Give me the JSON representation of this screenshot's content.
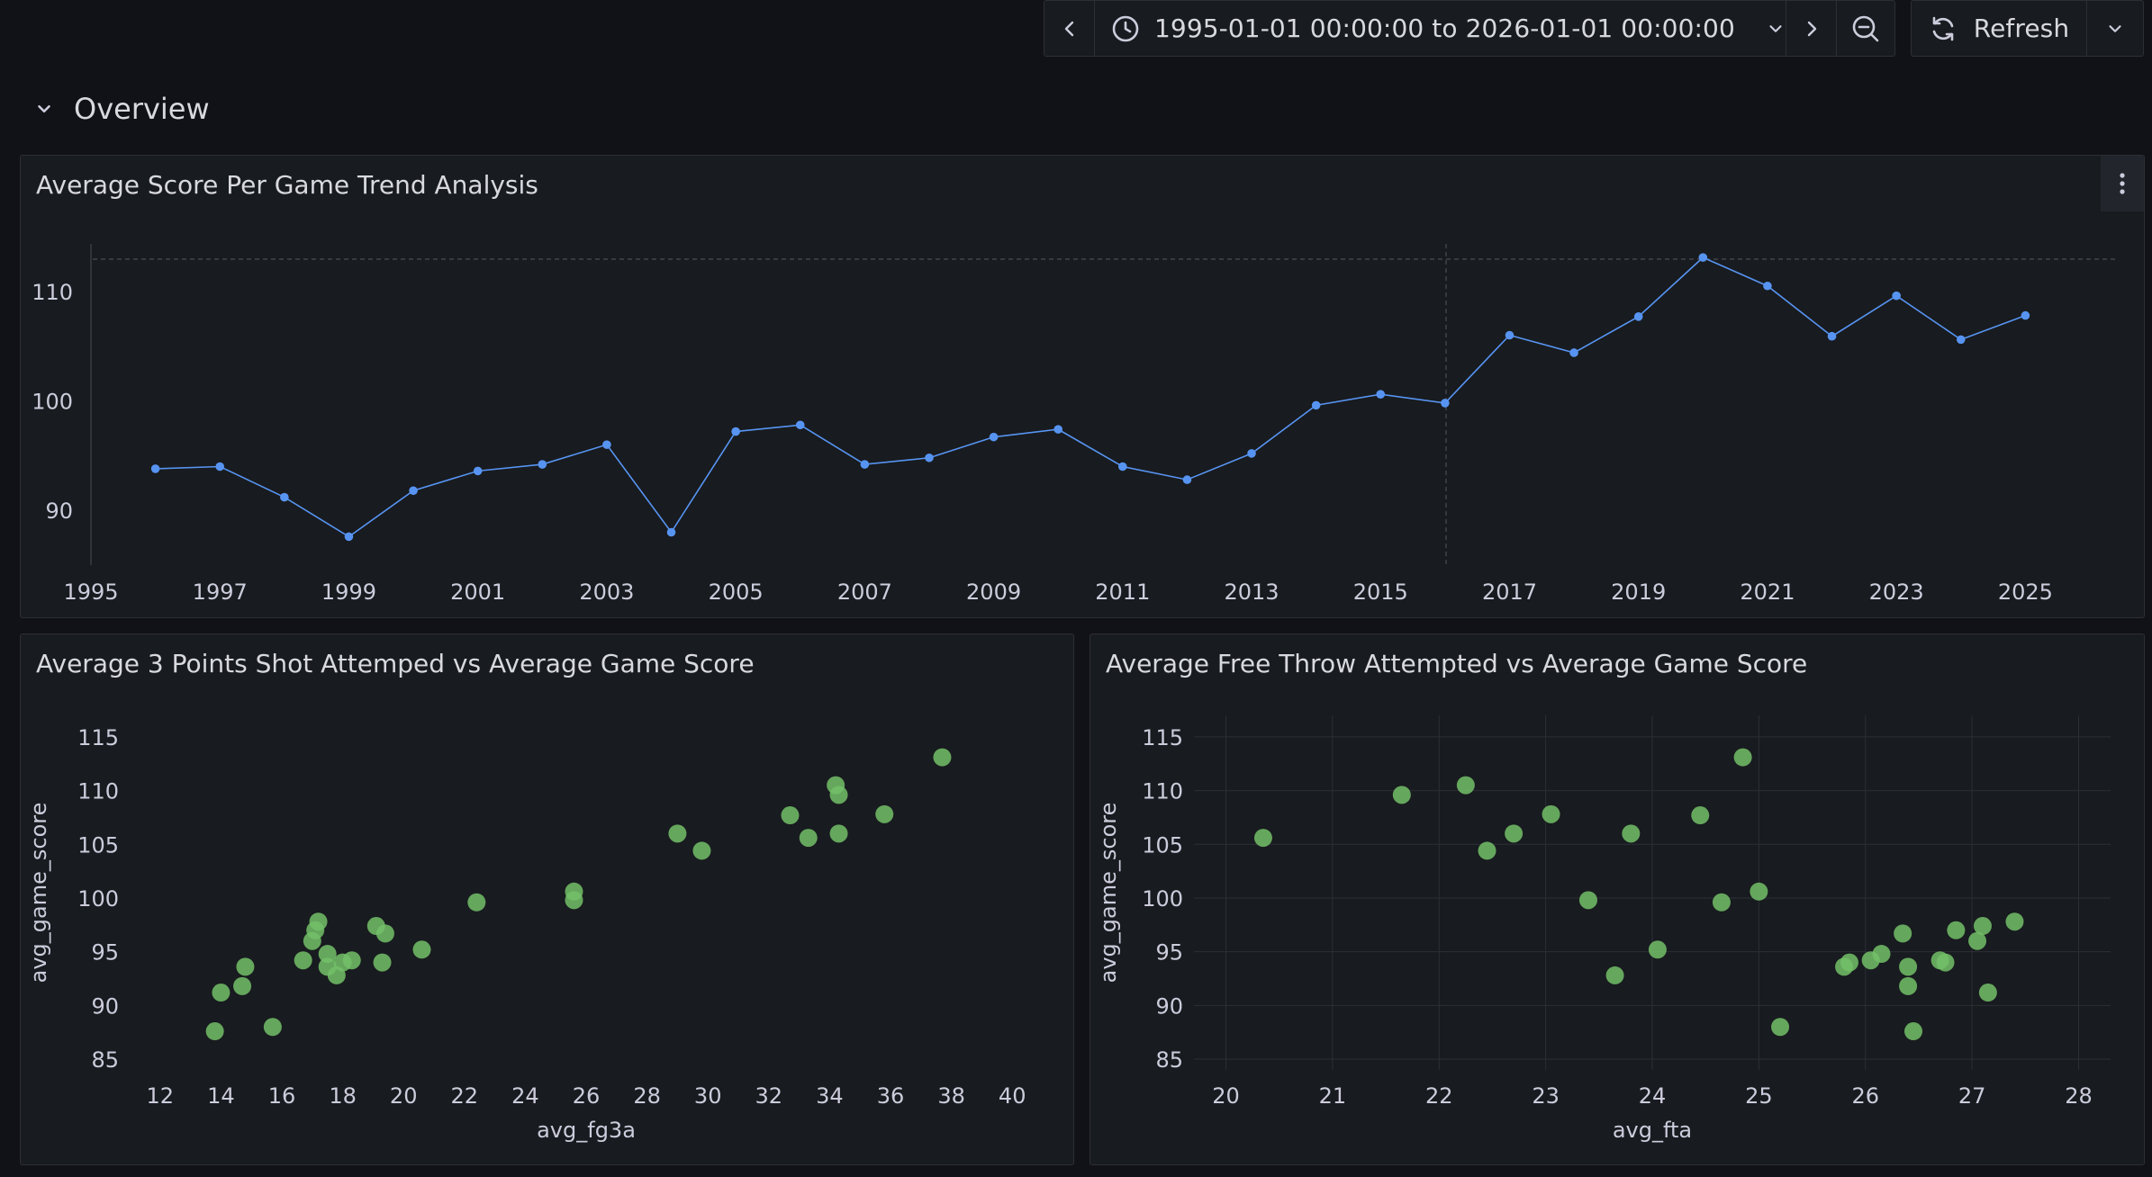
{
  "toolbar": {
    "time_range": "1995-01-01 00:00:00 to 2026-01-01 00:00:00",
    "refresh_label": "Refresh"
  },
  "row": {
    "title": "Overview"
  },
  "colors": {
    "line": "#5794f2",
    "points": "#73bf69",
    "grid": "#2c2f36",
    "text": "#ccccdc",
    "bg": "#181b1f"
  },
  "panels": {
    "trend": {
      "title": "Average Score Per Game Trend Analysis"
    },
    "fg3a": {
      "title": "Average 3 Points Shot Attemped vs Average Game Score"
    },
    "fta": {
      "title": "Average Free Throw Attempted vs Average Game Score"
    }
  },
  "chart_data": [
    {
      "type": "line",
      "title": "Average Score Per Game Trend Analysis",
      "x": [
        1996,
        1997,
        1998,
        1999,
        2000,
        2001,
        2002,
        2003,
        2004,
        2005,
        2006,
        2007,
        2008,
        2009,
        2010,
        2011,
        2012,
        2013,
        2014,
        2015,
        2016,
        2017,
        2018,
        2019,
        2020,
        2021,
        2022,
        2023,
        2024,
        2025
      ],
      "series": [
        {
          "values": [
            93.8,
            94.0,
            91.2,
            87.6,
            91.8,
            93.6,
            94.2,
            96.0,
            88.0,
            97.2,
            97.8,
            94.2,
            94.8,
            96.7,
            97.4,
            94.0,
            92.8,
            95.2,
            99.6,
            100.6,
            99.8,
            106.0,
            104.4,
            107.7,
            113.1,
            110.5,
            105.9,
            109.6,
            105.6,
            107.8
          ]
        }
      ],
      "xlim": [
        1995,
        2026
      ],
      "ylim": [
        85,
        115
      ],
      "x_ticks": [
        "1995",
        "1997",
        "1999",
        "2001",
        "2003",
        "2005",
        "2007",
        "2009",
        "2011",
        "2013",
        "2015",
        "2017",
        "2019",
        "2021",
        "2023",
        "2025"
      ],
      "y_ticks": [
        "90",
        "100",
        "110"
      ],
      "grid": false
    },
    {
      "type": "scatter",
      "title": "Average 3 Points Shot Attemped vs Average Game Score",
      "xlabel": "avg_fg3a",
      "ylabel": "avg_game_score",
      "xlim": [
        11,
        41
      ],
      "ylim": [
        84,
        117
      ],
      "x_ticks": [
        "12",
        "14",
        "16",
        "18",
        "20",
        "22",
        "24",
        "26",
        "28",
        "30",
        "32",
        "34",
        "36",
        "38",
        "40"
      ],
      "y_ticks": [
        "85",
        "90",
        "95",
        "100",
        "105",
        "110",
        "115"
      ],
      "grid": false,
      "points": [
        [
          37.7,
          113.1
        ],
        [
          34.2,
          110.5
        ],
        [
          34.3,
          109.6
        ],
        [
          35.8,
          107.8
        ],
        [
          32.7,
          107.7
        ],
        [
          34.3,
          106.0
        ],
        [
          33.3,
          105.6
        ],
        [
          29.0,
          106.0
        ],
        [
          29.8,
          104.4
        ],
        [
          25.6,
          100.6
        ],
        [
          25.6,
          99.8
        ],
        [
          22.4,
          99.6
        ],
        [
          20.6,
          95.2
        ],
        [
          19.1,
          97.4
        ],
        [
          19.4,
          96.7
        ],
        [
          19.3,
          94.0
        ],
        [
          17.2,
          97.8
        ],
        [
          17.1,
          97.0
        ],
        [
          17.0,
          96.0
        ],
        [
          17.5,
          94.8
        ],
        [
          18.3,
          94.2
        ],
        [
          16.7,
          94.2
        ],
        [
          17.5,
          93.6
        ],
        [
          18.0,
          94.0
        ],
        [
          17.8,
          92.8
        ],
        [
          14.8,
          93.6
        ],
        [
          14.7,
          91.8
        ],
        [
          14.0,
          91.2
        ],
        [
          15.7,
          88.0
        ],
        [
          13.8,
          87.6
        ]
      ]
    },
    {
      "type": "scatter",
      "title": "Average Free Throw Attempted vs Average Game Score",
      "xlabel": "avg_fta",
      "ylabel": "avg_game_score",
      "xlim": [
        19.7,
        28.3
      ],
      "ylim": [
        84,
        117
      ],
      "x_ticks": [
        "20",
        "21",
        "22",
        "23",
        "24",
        "25",
        "26",
        "27",
        "28"
      ],
      "y_ticks": [
        "85",
        "90",
        "95",
        "100",
        "105",
        "110",
        "115"
      ],
      "grid": true,
      "points": [
        [
          20.35,
          105.6
        ],
        [
          21.65,
          109.6
        ],
        [
          22.25,
          110.5
        ],
        [
          22.45,
          104.4
        ],
        [
          22.7,
          106.0
        ],
        [
          23.05,
          107.8
        ],
        [
          23.4,
          99.8
        ],
        [
          23.65,
          92.8
        ],
        [
          23.8,
          106.0
        ],
        [
          24.05,
          95.2
        ],
        [
          24.45,
          107.7
        ],
        [
          24.65,
          99.6
        ],
        [
          24.85,
          113.1
        ],
        [
          25.0,
          100.6
        ],
        [
          25.2,
          88.0
        ],
        [
          25.8,
          93.6
        ],
        [
          25.85,
          94.0
        ],
        [
          26.05,
          94.2
        ],
        [
          26.15,
          94.8
        ],
        [
          26.35,
          96.7
        ],
        [
          26.4,
          93.6
        ],
        [
          26.4,
          91.8
        ],
        [
          26.45,
          87.6
        ],
        [
          26.7,
          94.2
        ],
        [
          26.75,
          94.0
        ],
        [
          26.85,
          97.0
        ],
        [
          27.05,
          96.0
        ],
        [
          27.1,
          97.4
        ],
        [
          27.15,
          91.2
        ],
        [
          27.4,
          97.8
        ]
      ]
    }
  ]
}
